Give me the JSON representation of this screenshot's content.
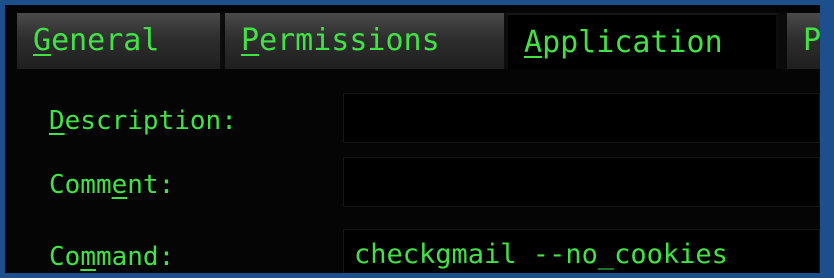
{
  "tabs": [
    {
      "pre": "",
      "mnemonic": "G",
      "post": "eneral"
    },
    {
      "pre": "",
      "mnemonic": "P",
      "post": "ermissions"
    },
    {
      "pre": "",
      "mnemonic": "A",
      "post": "pplication"
    },
    {
      "pre": "",
      "mnemonic": "",
      "post": "P"
    }
  ],
  "form": {
    "description": {
      "pre": "",
      "mnemonic": "D",
      "post": "escription:",
      "value": ""
    },
    "comment": {
      "pre": "Comm",
      "mnemonic": "e",
      "post": "nt:",
      "value": ""
    },
    "command": {
      "pre": "Co",
      "mnemonic": "m",
      "post": "mand:",
      "value": "checkgmail --no_cookies"
    }
  },
  "colors": {
    "text": "#42e246",
    "border": "#1d4f8d",
    "background": "#050505"
  }
}
